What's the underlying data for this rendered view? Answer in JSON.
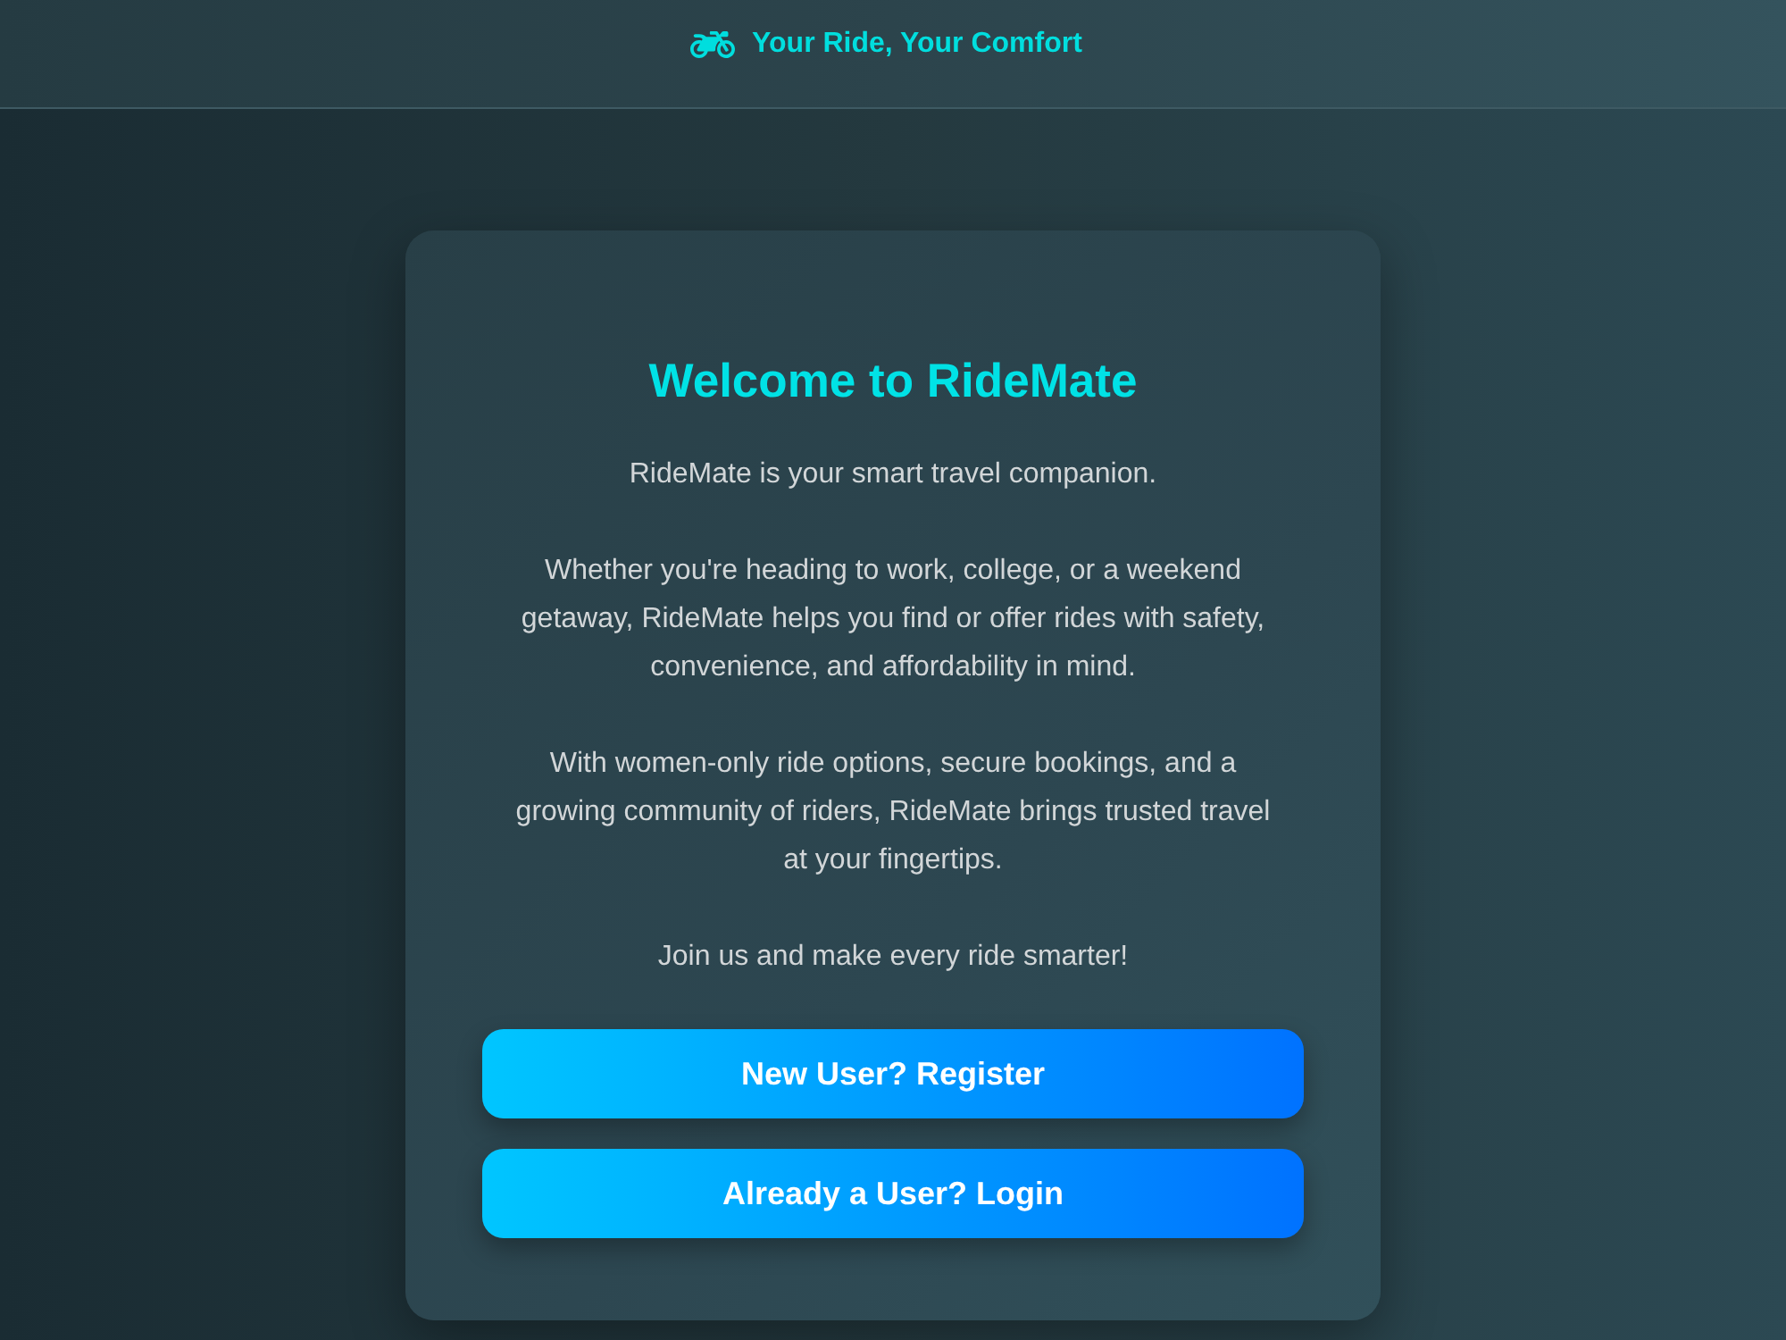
{
  "header": {
    "brand": "Your Ride, Your Comfort"
  },
  "card": {
    "title": "Welcome to RideMate",
    "paragraphs": [
      "RideMate is your smart travel companion.",
      "Whether you're heading to work, college, or a weekend getaway, RideMate helps you find or offer rides with safety, convenience, and affordability in mind.",
      "With women-only ride options, secure bookings, and a growing community of riders, RideMate brings trusted travel at your fingertips.",
      "Join us and make every ride smarter!"
    ],
    "buttons": [
      "New User? Register",
      "Already a User? Login"
    ]
  }
}
